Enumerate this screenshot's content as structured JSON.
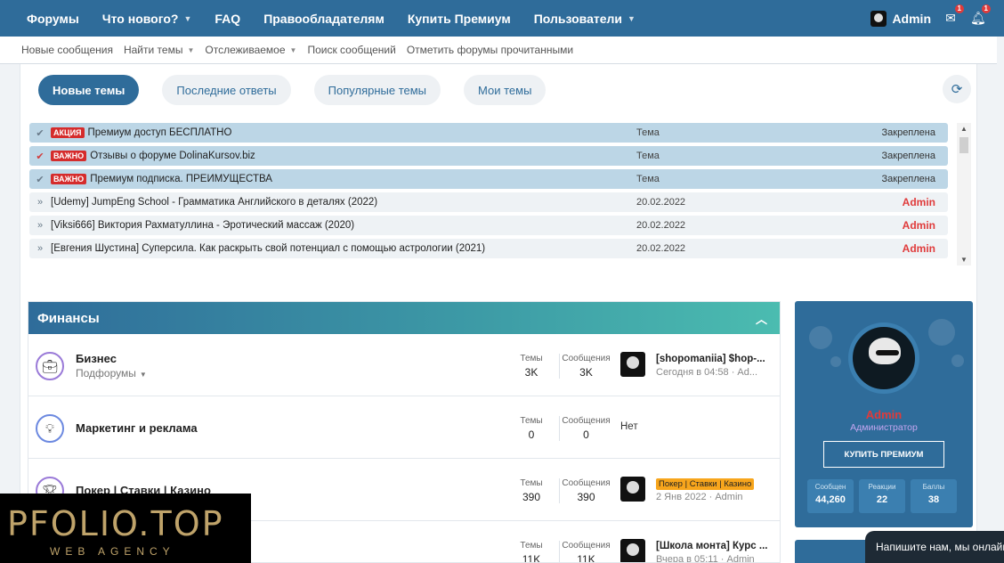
{
  "topnav": {
    "items": [
      "Форумы",
      "Что нового?",
      "FAQ",
      "Правообладателям",
      "Купить Премиум",
      "Пользователи"
    ],
    "user": "Admin",
    "inbox_count": "1",
    "alerts_count": "1"
  },
  "subnav": {
    "items": [
      "Новые сообщения",
      "Найти темы",
      "Отслеживаемое",
      "Поиск сообщений",
      "Отметить форумы прочитанными"
    ]
  },
  "tabs": [
    "Новые темы",
    "Последние ответы",
    "Популярные темы",
    "Мои темы"
  ],
  "threads": [
    {
      "prefix": "АКЦИЯ",
      "title": "Премиум доступ БЕСПЛАТНО",
      "date": "Тема",
      "stat": "Закреплена"
    },
    {
      "prefix": "ВАЖНО",
      "title": "Отзывы о форуме DolinaKursov.biz",
      "date": "Тема",
      "stat": "Закреплена"
    },
    {
      "prefix": "ВАЖНО",
      "title": "Премиум подписка. ПРЕИМУЩЕСТВА",
      "date": "Тема",
      "stat": "Закреплена"
    },
    {
      "prefix": "",
      "title": "[Udemy] JumpEng School - Грамматика Английского в деталях (2022)",
      "date": "20.02.2022",
      "stat": "Admin"
    },
    {
      "prefix": "",
      "title": "[Viksi666] Виктория Рахматуллина - Эротический массаж (2020)",
      "date": "20.02.2022",
      "stat": "Admin"
    },
    {
      "prefix": "",
      "title": "[Евгения Шустина] Суперсила. Как раскрыть свой потенциал с помощью астрологии (2021)",
      "date": "20.02.2022",
      "stat": "Admin"
    }
  ],
  "forum_block": {
    "title": "Финансы",
    "stat_labels": {
      "threads": "Темы",
      "messages": "Сообщения"
    },
    "forums": [
      {
        "name": "Бизнес",
        "sub": "Подфорумы",
        "threads": "3K",
        "messages": "3K",
        "last_title": "[shopomaniia] $hop-...",
        "last_meta": "Сегодня в 04:58 · Ad..."
      },
      {
        "name": "Маркетинг и реклама",
        "sub": "",
        "threads": "0",
        "messages": "0",
        "last_none": "Нет"
      },
      {
        "name": "Покер | Ставки | Казино",
        "sub": "",
        "threads": "390",
        "messages": "390",
        "last_tag": "Покер | Ставки | Казино",
        "last_meta": "2 Янв 2022 · Admin"
      },
      {
        "name": "",
        "sub": "",
        "threads": "11K",
        "messages": "11K",
        "last_title": "[Школа монта] Курс ...",
        "last_meta": "Вчера в 05:11 · Admin"
      }
    ]
  },
  "profile": {
    "name": "Admin",
    "role": "Администратор",
    "button": "КУПИТЬ ПРЕМИУМ",
    "stats": [
      {
        "label": "Сообщен",
        "value": "44,260"
      },
      {
        "label": "Реакции",
        "value": "22"
      },
      {
        "label": "Баллы",
        "value": "38"
      }
    ]
  },
  "watermark": {
    "main": "PFOLIO.TOP",
    "sub": "WEB AGENCY"
  },
  "chat": {
    "text": "Напишите нам, мы онлайн!"
  }
}
